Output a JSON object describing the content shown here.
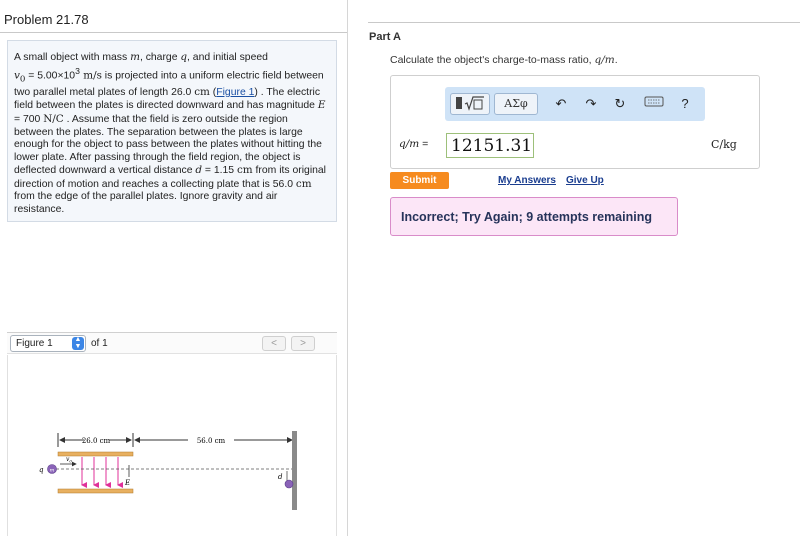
{
  "problem": {
    "title": "Problem 21.78",
    "text": {
      "p1": "A small object with mass ",
      "sym_m": "m",
      "p2": ", charge ",
      "sym_q": "q",
      "p3": ", and initial speed",
      "sym_v0": "v",
      "sub0": "0",
      "p4": " = 5.00×10",
      "sup3": "3",
      "unit_ms": " m/s",
      "p5": " is projected into a uniform electric field between two parallel metal plates of length 26.0 ",
      "unit_cm": "cm",
      "figure_link": "Figure 1",
      "p6": " . The electric field between the plates is directed downward and has magnitude ",
      "sym_E": "E",
      "p7": " = 700 ",
      "unit_nc": "N/C",
      "p8": " . Assume that the field is zero outside the region between the plates. The separation between the plates is large enough for the object to pass between the plates without hitting the lower plate. After passing through the field region, the object is deflected downward a vertical distance ",
      "sym_d": "d",
      "p9": " = 1.15 ",
      "p10": " from its original direction of motion and reaches a collecting plate that is 56.0 ",
      "p11": " from the edge of the parallel plates. Ignore gravity and air resistance."
    }
  },
  "figure_nav": {
    "selected": "Figure 1",
    "of_label": "of 1",
    "prev": "<",
    "next": ">"
  },
  "figure": {
    "dim_plates": "26.0 cm",
    "dim_gap": "56.0 cm",
    "label_q": "q",
    "label_m": "m",
    "label_v": "v",
    "label_v_sub": "0",
    "label_E": "E",
    "label_d": "d",
    "colors": {
      "plate": "#e8b060",
      "field": "#e0309a",
      "particle": "#8a63b8",
      "screen": "#888888"
    }
  },
  "part": {
    "title": "Part A",
    "question_text": "Calculate the object's charge-to-mass ratio, ",
    "question_math": "q/m",
    "question_end": "."
  },
  "toolbar": {
    "templates_icon": "templates-icon",
    "symbols_label": "ΑΣφ",
    "undo_icon": "undo-icon",
    "redo_icon": "redo-icon",
    "reset_icon": "reset-icon",
    "keyboard_icon": "keyboard-icon",
    "help_label": "?"
  },
  "answer": {
    "label_math": "q/m",
    "label_eq": " =",
    "value": "12151.31",
    "unit": "C/kg"
  },
  "actions": {
    "submit": "Submit",
    "my_answers": "My Answers",
    "give_up": "Give Up"
  },
  "feedback": {
    "message": "Incorrect; Try Again; 9 attempts remaining",
    "bg_color": "#fce6f7",
    "border_color": "#d98cc9"
  }
}
